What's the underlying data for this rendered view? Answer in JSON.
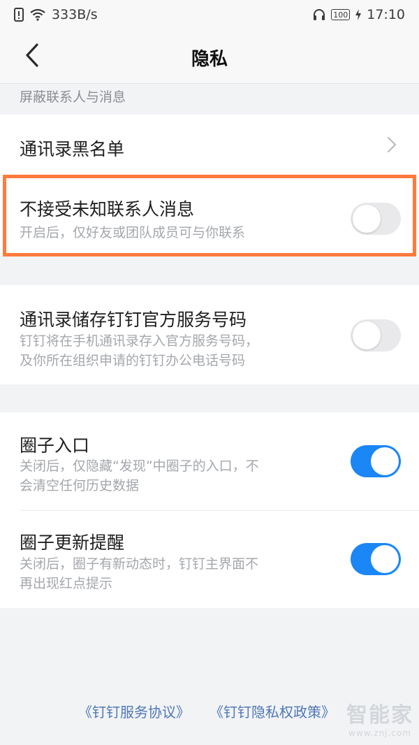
{
  "status_bar": {
    "speed": "333B/s",
    "battery": "100",
    "time": "17:10"
  },
  "header": {
    "title": "隐私",
    "back_icon": "chevron-left-icon"
  },
  "section_label": "屏蔽联系人与消息",
  "rows": {
    "blacklist": {
      "title": "通讯录黑名单"
    },
    "unknown_contacts": {
      "title": "不接受未知联系人消息",
      "subtitle": "开启后，仅好友或团队成员可与你联系",
      "enabled": false
    },
    "official_numbers": {
      "title": "通讯录储存钉钉官方服务号码",
      "subtitle_line1": "钉钉将在手机通讯录存入官方服务号码，",
      "subtitle_line2": "及你所在组织申请的钉钉办公电话号码",
      "enabled": false
    },
    "circle_entry": {
      "title": "圈子入口",
      "subtitle_line1": "关闭后，仅隐藏“发现”中圈子的入口，不",
      "subtitle_line2": "会清空任何历史数据",
      "enabled": true
    },
    "circle_reminder": {
      "title": "圈子更新提醒",
      "subtitle_line1": "关闭后，圈子有新动态时，钉钉主界面不",
      "subtitle_line2": "再出现红点提示",
      "enabled": true
    }
  },
  "footer": {
    "service_agreement": "《钉钉服务协议》",
    "privacy_policy": "《钉钉隐私权政策》"
  },
  "watermark": {
    "main": "智能家",
    "sub": "www.znj.com"
  },
  "colors": {
    "toggle_on": "#1b86f6",
    "toggle_off": "#e9e9eb",
    "highlight": "#ff7a3d",
    "link": "#4f78b6"
  }
}
